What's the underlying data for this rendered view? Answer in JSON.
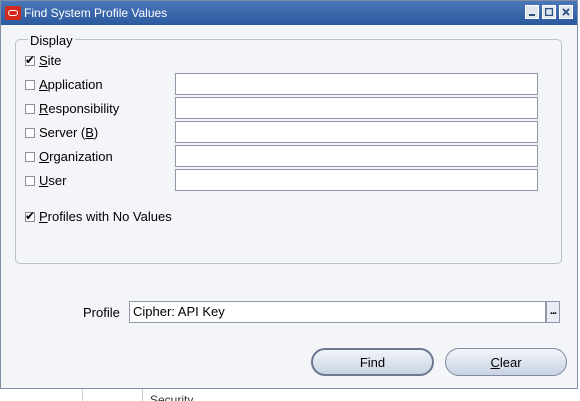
{
  "window": {
    "title": "Find System Profile Values",
    "controls": [
      "minimize-icon",
      "maximize-icon",
      "close-icon"
    ]
  },
  "display_group": {
    "label": "Display",
    "options": [
      {
        "label": "Site",
        "checked": true,
        "has_field": false,
        "value": ""
      },
      {
        "label": "Application",
        "checked": false,
        "has_field": true,
        "value": ""
      },
      {
        "label": "Responsibility",
        "checked": false,
        "has_field": true,
        "value": ""
      },
      {
        "label": "Server (B)",
        "checked": false,
        "has_field": true,
        "value": ""
      },
      {
        "label": "Organization",
        "checked": false,
        "has_field": true,
        "value": ""
      },
      {
        "label": "User",
        "checked": false,
        "has_field": true,
        "value": ""
      }
    ],
    "profiles_no_values": {
      "label": "Profiles with No Values",
      "checked": true
    }
  },
  "profile": {
    "label": "Profile",
    "value": "Cipher: API Key",
    "lov_label": "..."
  },
  "buttons": {
    "find": "Find",
    "clear": "Clear"
  },
  "background": {
    "peek_text": "Security"
  },
  "colors": {
    "titlebar": "#2c5aa0",
    "logo": "#d52b1e",
    "panel": "#f4f5f8"
  }
}
